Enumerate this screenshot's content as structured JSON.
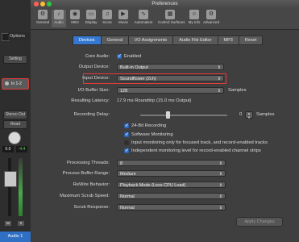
{
  "left_panel": {
    "options_label": "Options",
    "setting_button": "Setting",
    "input_channel": "In 1-2",
    "stereo_out": "Stereo Out",
    "read_button": "Read",
    "value_left": "0.0",
    "value_right": "-4.4",
    "m_label": "M",
    "s_label": "S",
    "track_name": "Audio 1"
  },
  "window": {
    "title": "Preferences",
    "toolbar": [
      {
        "label": "General",
        "icon": "general-icon"
      },
      {
        "label": "Audio",
        "icon": "audio-icon"
      },
      {
        "label": "MIDI",
        "icon": "midi-icon"
      },
      {
        "label": "Display",
        "icon": "display-icon"
      },
      {
        "label": "Score",
        "icon": "score-icon"
      },
      {
        "label": "Movie",
        "icon": "movie-icon"
      },
      {
        "label": "Automation",
        "icon": "automation-icon"
      },
      {
        "label": "Control Surfaces",
        "icon": "control-surfaces-icon"
      },
      {
        "label": "My Info",
        "icon": "my-info-icon"
      },
      {
        "label": "Advanced",
        "icon": "advanced-icon"
      }
    ],
    "tabs": [
      "Devices",
      "General",
      "I/O Assignments",
      "Audio File Editor",
      "MP3",
      "Reset"
    ],
    "active_tab": "Devices"
  },
  "devices": {
    "core_audio_label": "Core Audio:",
    "core_audio_enabled": "Enabled",
    "output_device_label": "Output Device:",
    "output_device_value": "Built-in Output",
    "input_device_label": "Input Device:",
    "input_device_value": "Soundflower (2ch)",
    "io_buffer_label": "I/O Buffer Size:",
    "io_buffer_value": "128",
    "io_buffer_unit": "Samples",
    "latency_label": "Resulting Latency:",
    "latency_value": "17.9 ms Roundtrip (15.0 ms Output)",
    "recording_delay_label": "Recording Delay:",
    "recording_delay_value": "0",
    "recording_delay_unit": "Samples",
    "checkboxes": [
      {
        "label": "24-Bit Recording",
        "checked": true
      },
      {
        "label": "Software Monitoring",
        "checked": true
      },
      {
        "label": "Input monitoring only for focused track, and record-enabled tracks",
        "checked": false
      },
      {
        "label": "Independent monitoring level for record-enabled channel strips",
        "checked": true
      }
    ],
    "processing_threads_label": "Processing Threads:",
    "processing_threads_value": "8",
    "process_buffer_label": "Process Buffer Range:",
    "process_buffer_value": "Medium",
    "rewire_label": "ReWire Behavior:",
    "rewire_value": "Playback Mode (Less CPU Load)",
    "max_scrub_label": "Maximum Scrub Speed:",
    "max_scrub_value": "Normal",
    "scrub_response_label": "Scrub Response:",
    "scrub_response_value": "Normal",
    "apply_button": "Apply Changes"
  },
  "colors": {
    "accent": "#3678d1",
    "highlight": "#e23a3a",
    "track": "#2f6fc4"
  }
}
